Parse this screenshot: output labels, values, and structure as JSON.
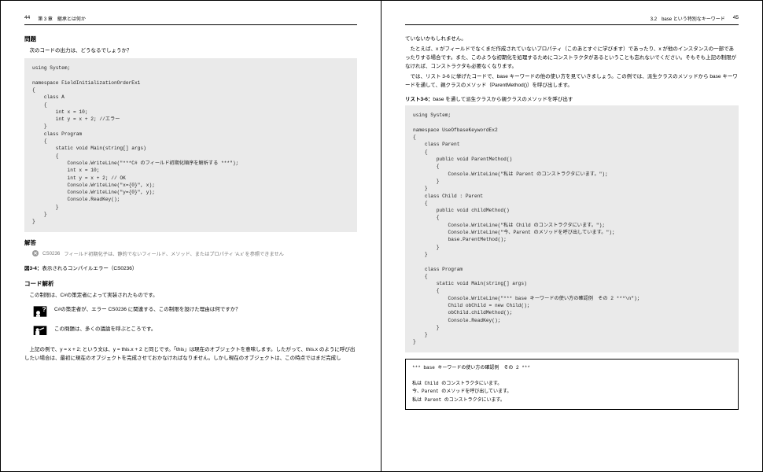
{
  "left": {
    "page_number": "44",
    "chapter": "第 3 章　継承とは何か",
    "sec_problem": "問題",
    "problem_text": "次のコードの出力は、どうなるでしょうか？",
    "code1": "using System;\n\nnamespace FieldInitializationOrderEx1\n{\n    class A\n    {\n        int x = 10;\n        int y = x + 2; //エラー\n    }\n    class Program\n    {\n        static void Main(string[] args)\n        {\n            Console.WriteLine(\"***C# のフィールド初期化順序を解析する ***\");\n            int x = 10;\n            int y = x + 2; // OK\n            Console.WriteLine(\"x={0}\", x);\n            Console.WriteLine(\"y={0}\", y);\n            Console.ReadKey();\n        }\n    }\n}",
    "sec_answer": "解答",
    "error_code": "CS0236",
    "error_msg": "フィールド初期化子は、静的でないフィールド、メソッド、またはプロパティ 'A.x' を参照できません",
    "fig_label_bold": "図3-4：",
    "fig_label_text": "表示されるコンパイルエラー（CS0236）",
    "sec_analysis": "コード解析",
    "analysis_intro": "この制限は、C#の策定者によって実装されたものです。",
    "q_text": "C#の策定者が、エラー CS0236 に関連する、この制限を設けた理由は何ですか？",
    "a_text": "この問題は、多くの議論を呼ぶところです。",
    "para1": "上記の例で、y = x + 2; という文は、y = this.x + 2 と同じです。「this」は現在のオブジェクトを意味します。したがって、this.x のように呼び出したい場合は、最初に現在のオブジェクトを完成させておかなければなりません。しかし現在のオブジェクトは、この時点ではまだ完成し"
  },
  "right": {
    "page_number": "45",
    "section": "3.2　base という特別なキーワード",
    "para2": "ていないかもしれません。",
    "para3": "たとえば、x がフィールドでなくまだ作成されていないプロパティ（このあとすぐに学びます）であったり、x が他のインスタンスの一部であったりする場合です。また、このような初期化を処理するためにコンストラクタがあるということも忘れないでください。そもそも上記の制限がなければ、コンストラクタも必要なくなります。",
    "para4": "では、リスト 3-6 に挙げたコードで、base キーワードの他の使い方を見ていきましょう。この例では、派生クラスのメソッドから base キーワードを通して、親クラスのメソッド（ParentMethod()）を呼び出します。",
    "listing_bold": "リスト3-6：",
    "listing_text": "base を通して派生クラスから親クラスのメソッドを呼び出す",
    "code2": "using System;\n\nnamespace UseOfbaseKeywordEx2\n{\n    class Parent\n    {\n        public void ParentMethod()\n        {\n            Console.WriteLine(\"私は Parent のコンストラクタにいます。\");\n        }\n    }\n    class Child : Parent\n    {\n        public void childMethod()\n        {\n            Console.WriteLine(\"私は Child のコンストラクタにいます。\");\n            Console.WriteLine(\"今、Parent のメソッドを呼び出しています。\");\n            base.ParentMethod();\n        }\n    }\n\n    class Program\n    {\n        static void Main(string[] args)\n        {\n            Console.WriteLine(\"*** base キーワードの使い方の確認例　その 2 ***\\n\");\n            Child obChild = new Child();\n            obChild.childMethod();\n            Console.ReadKey();\n        }\n    }\n}",
    "output": "*** base キーワードの使い方の確認例　その 2 ***\n\n私は Child のコンストラクタにいます。\n今、Parent のメソッドを呼び出しています。\n私は Parent のコンストラクタにいます。"
  }
}
